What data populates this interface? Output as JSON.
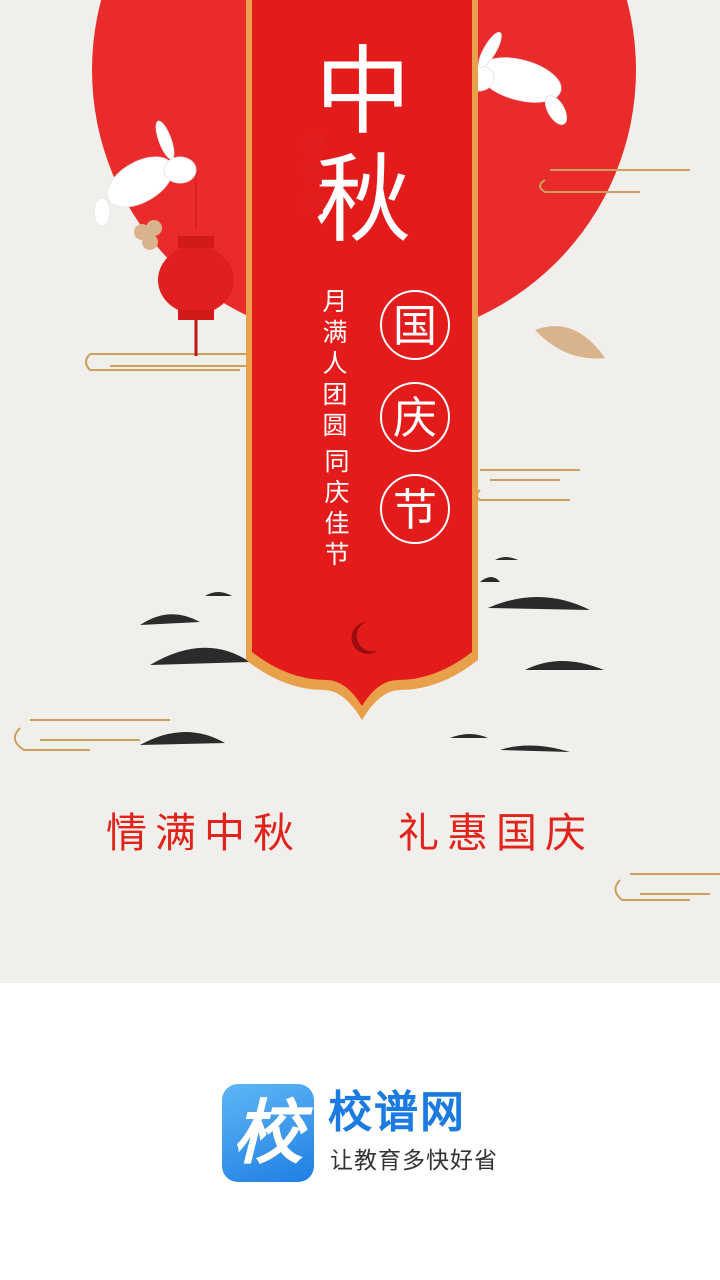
{
  "poster": {
    "site_small": "校谱网",
    "title_chars": [
      "中",
      "秋"
    ],
    "subtitle_left": "月满人团圆",
    "subtitle_right": "同庆佳节",
    "circle_chars": [
      "国",
      "庆",
      "节"
    ],
    "slogan_left": "情满中秋",
    "slogan_right": "礼惠国庆"
  },
  "brand": {
    "icon_char": "校",
    "name": "校谱网",
    "tagline": "让教育多快好省"
  },
  "colors": {
    "red": "#e41b1b",
    "sun_red": "#ea2b2b",
    "gold": "#c9a15d",
    "paper": "#f0efeb",
    "brand_blue": "#1c7be0"
  }
}
